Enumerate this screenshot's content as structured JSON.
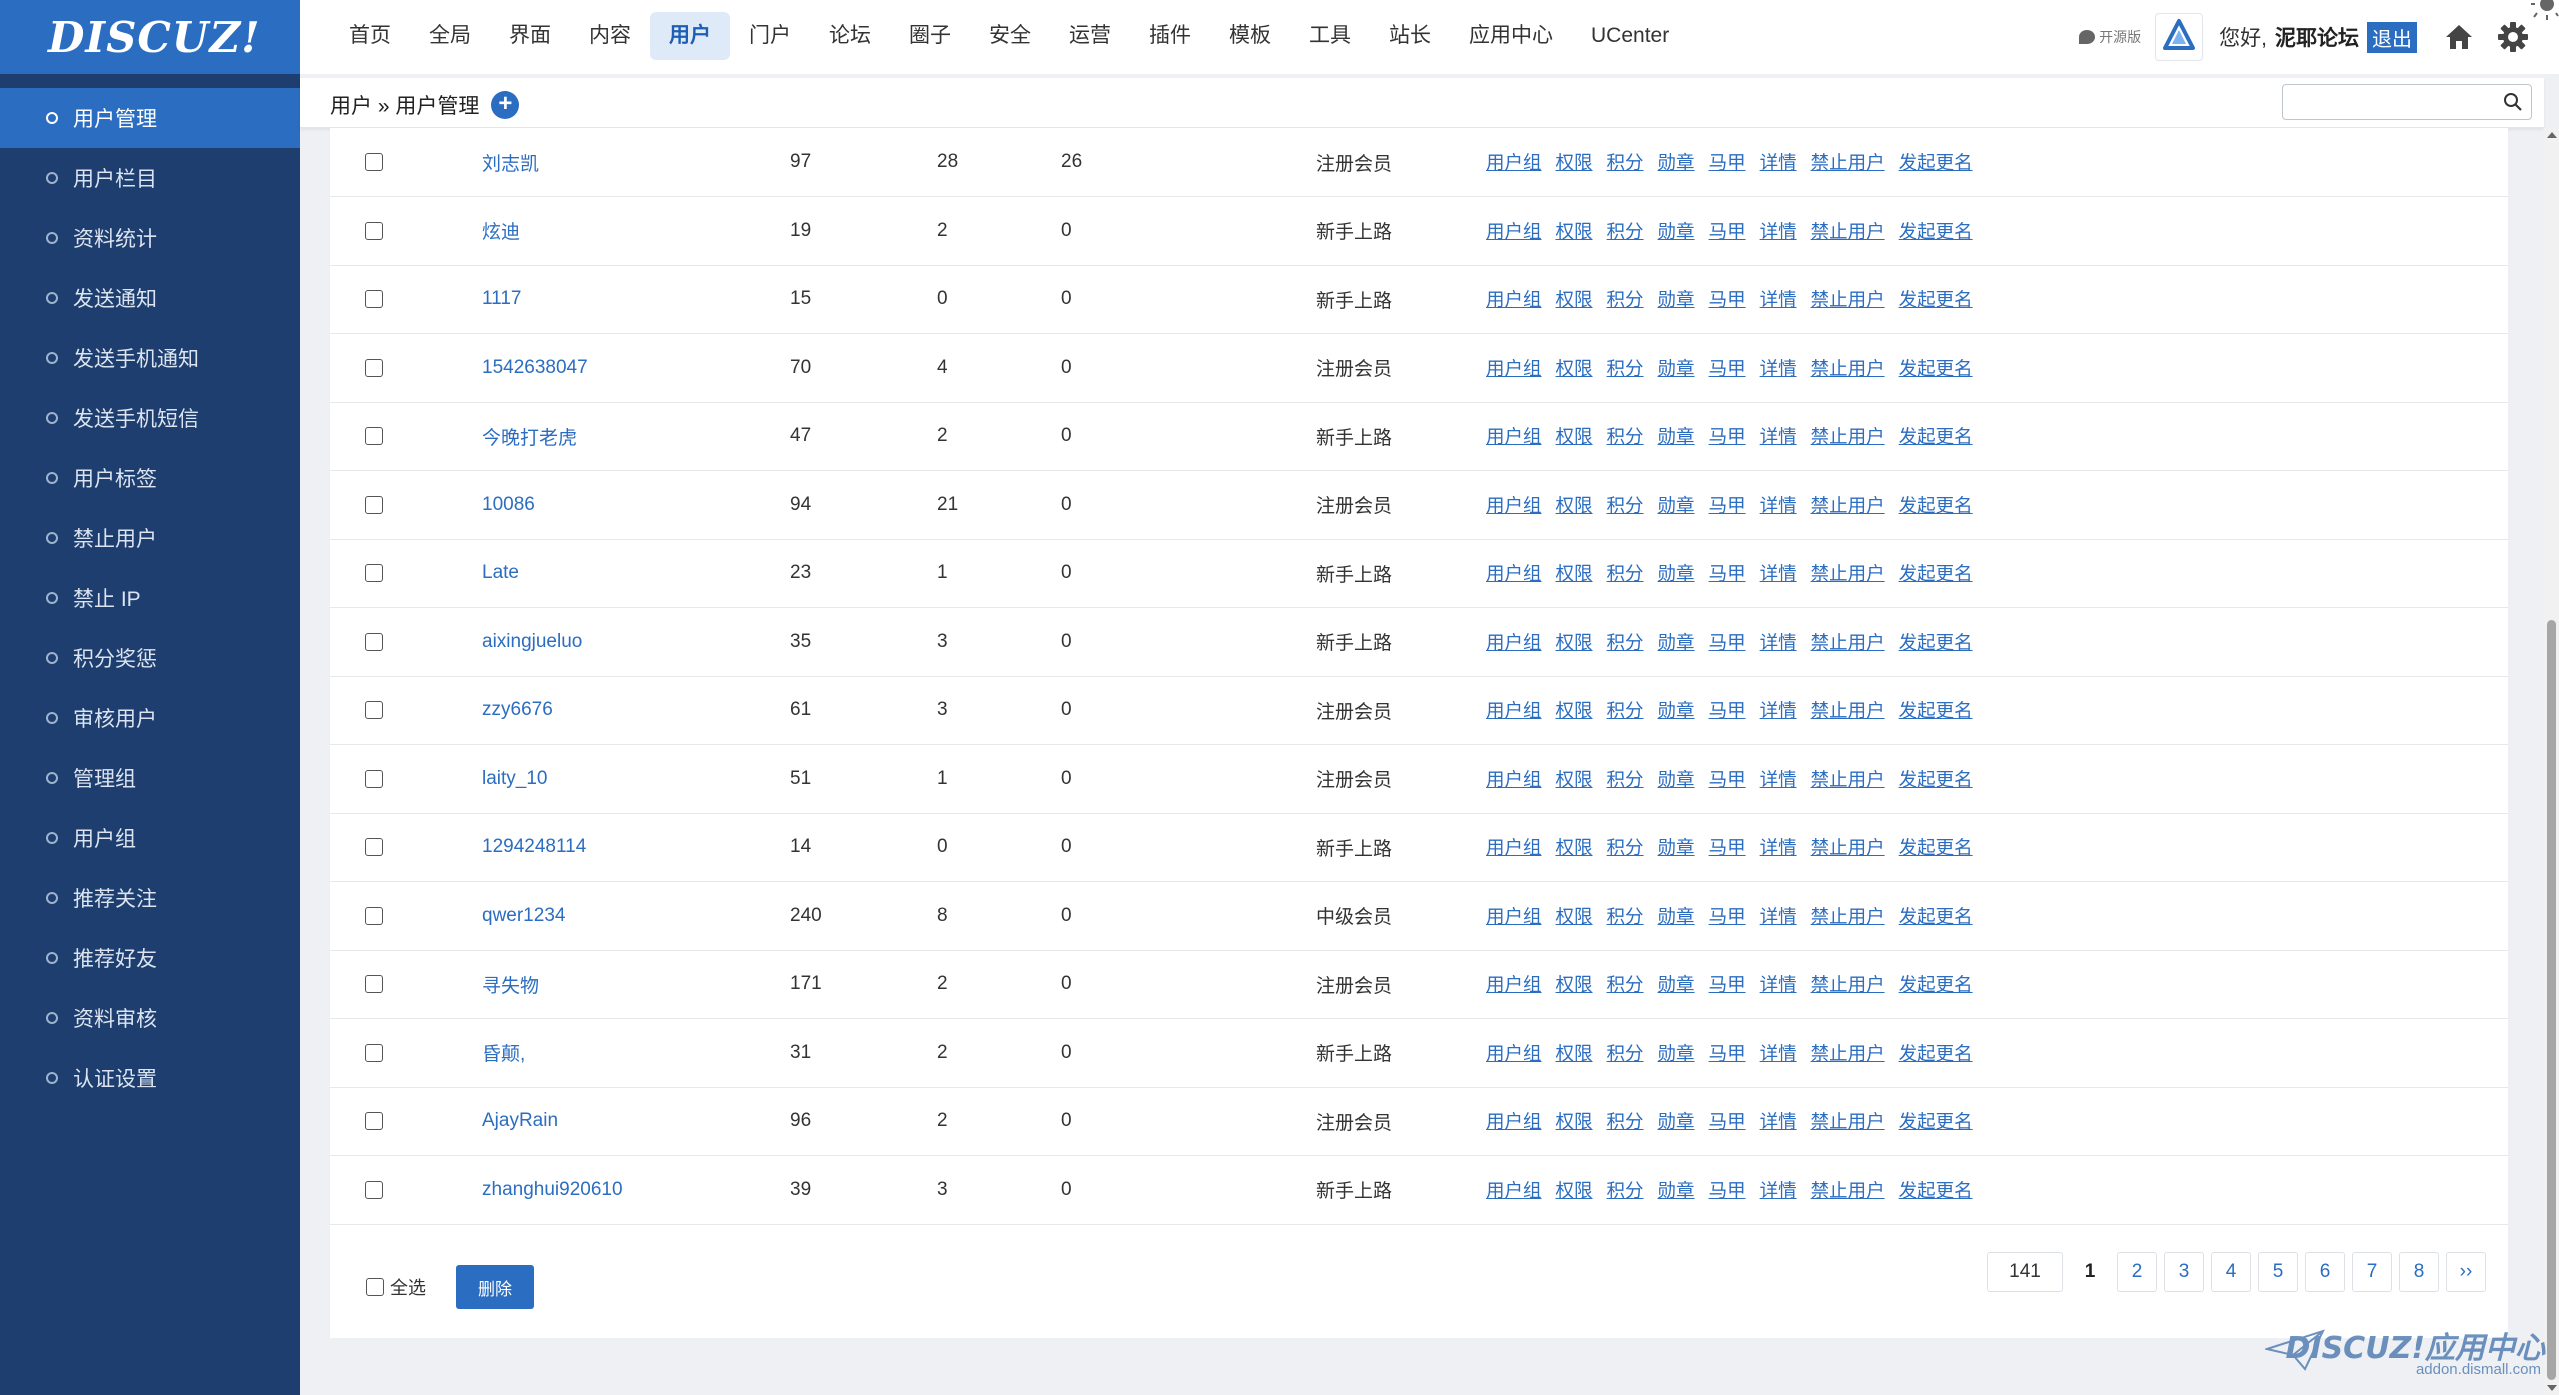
{
  "logo": "DISCUZ!",
  "sidebar": {
    "items": [
      {
        "label": "用户管理",
        "active": true
      },
      {
        "label": "用户栏目"
      },
      {
        "label": "资料统计"
      },
      {
        "label": "发送通知"
      },
      {
        "label": "发送手机通知"
      },
      {
        "label": "发送手机短信"
      },
      {
        "label": "用户标签"
      },
      {
        "label": "禁止用户"
      },
      {
        "label": "禁止 IP"
      },
      {
        "label": "积分奖惩"
      },
      {
        "label": "审核用户"
      },
      {
        "label": "管理组"
      },
      {
        "label": "用户组"
      },
      {
        "label": "推荐关注"
      },
      {
        "label": "推荐好友"
      },
      {
        "label": "资料审核"
      },
      {
        "label": "认证设置"
      }
    ]
  },
  "topnav": {
    "items": [
      "首页",
      "全局",
      "界面",
      "内容",
      "用户",
      "门户",
      "论坛",
      "圈子",
      "安全",
      "运营",
      "插件",
      "模板",
      "工具",
      "站长",
      "应用中心",
      "UCenter"
    ],
    "active": "用户"
  },
  "header": {
    "edition": "开源版",
    "greeting": "您好,",
    "username": "泥耶论坛",
    "logout": "退出"
  },
  "breadcrumb": {
    "text": "用户 » 用户管理",
    "add": "+"
  },
  "search": {
    "placeholder": "",
    "value": ""
  },
  "table": {
    "ops": [
      "用户组",
      "权限",
      "积分",
      "勋章",
      "马甲",
      "详情",
      "禁止用户",
      "发起更名"
    ],
    "rows": [
      {
        "name": "刘志凯",
        "a": "97",
        "b": "28",
        "c": "26",
        "group": "注册会员"
      },
      {
        "name": "炫迪",
        "a": "19",
        "b": "2",
        "c": "0",
        "group": "新手上路"
      },
      {
        "name": "1117",
        "a": "15",
        "b": "0",
        "c": "0",
        "group": "新手上路"
      },
      {
        "name": "1542638047",
        "a": "70",
        "b": "4",
        "c": "0",
        "group": "注册会员"
      },
      {
        "name": "今晚打老虎",
        "a": "47",
        "b": "2",
        "c": "0",
        "group": "新手上路"
      },
      {
        "name": "10086",
        "a": "94",
        "b": "21",
        "c": "0",
        "group": "注册会员"
      },
      {
        "name": "Late",
        "a": "23",
        "b": "1",
        "c": "0",
        "group": "新手上路"
      },
      {
        "name": "aixingjueluo",
        "a": "35",
        "b": "3",
        "c": "0",
        "group": "新手上路"
      },
      {
        "name": "zzy6676",
        "a": "61",
        "b": "3",
        "c": "0",
        "group": "注册会员"
      },
      {
        "name": "laity_10",
        "a": "51",
        "b": "1",
        "c": "0",
        "group": "注册会员"
      },
      {
        "name": "1294248114",
        "a": "14",
        "b": "0",
        "c": "0",
        "group": "新手上路"
      },
      {
        "name": "qwer1234",
        "a": "240",
        "b": "8",
        "c": "0",
        "group": "中级会员"
      },
      {
        "name": "寻失物",
        "a": "171",
        "b": "2",
        "c": "0",
        "group": "注册会员"
      },
      {
        "name": "昏颠,",
        "a": "31",
        "b": "2",
        "c": "0",
        "group": "新手上路"
      },
      {
        "name": "AjayRain",
        "a": "96",
        "b": "2",
        "c": "0",
        "group": "注册会员"
      },
      {
        "name": "zhanghui920610",
        "a": "39",
        "b": "3",
        "c": "0",
        "group": "新手上路"
      }
    ]
  },
  "footer": {
    "select_all": "全选",
    "delete": "删除"
  },
  "pager": {
    "total": "141",
    "pages": [
      "1",
      "2",
      "3",
      "4",
      "5",
      "6",
      "7",
      "8"
    ],
    "current": "1",
    "next": "››"
  },
  "watermark": {
    "brand": "DISCUZ!应用中心",
    "url": "addon.dismall.com"
  }
}
